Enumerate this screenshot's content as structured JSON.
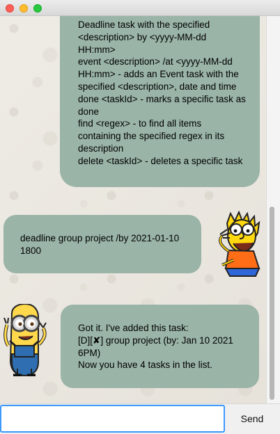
{
  "messages": {
    "help": "Deadline task with the specified\n<description> by <yyyy-MM-dd\nHH:mm>\nevent <description> /at <yyyy-MM-dd\nHH:mm> - adds an Event task with the\nspecified <description>, date and time\ndone <taskId> - marks a specific task as\ndone\nfind <regex> - to find all items\ncontaining the specified regex in its\ndescription\ndelete <taskId> - deletes a specific task",
    "user": "deadline group project /by 2021-01-10\n1800",
    "bot": "Got it. I've added this task:\n[D][✘] group project (by: Jan 10 2021\n6PM)\nNow you have 4 tasks in the list."
  },
  "input": {
    "value": ""
  },
  "send": {
    "label": "Send"
  },
  "icons": {
    "user_avatar": "bart-simpson-avatar",
    "bot_avatar": "minion-avatar"
  },
  "colors": {
    "bubble": "#9ab4a7",
    "input_focus": "#3b99fc"
  }
}
